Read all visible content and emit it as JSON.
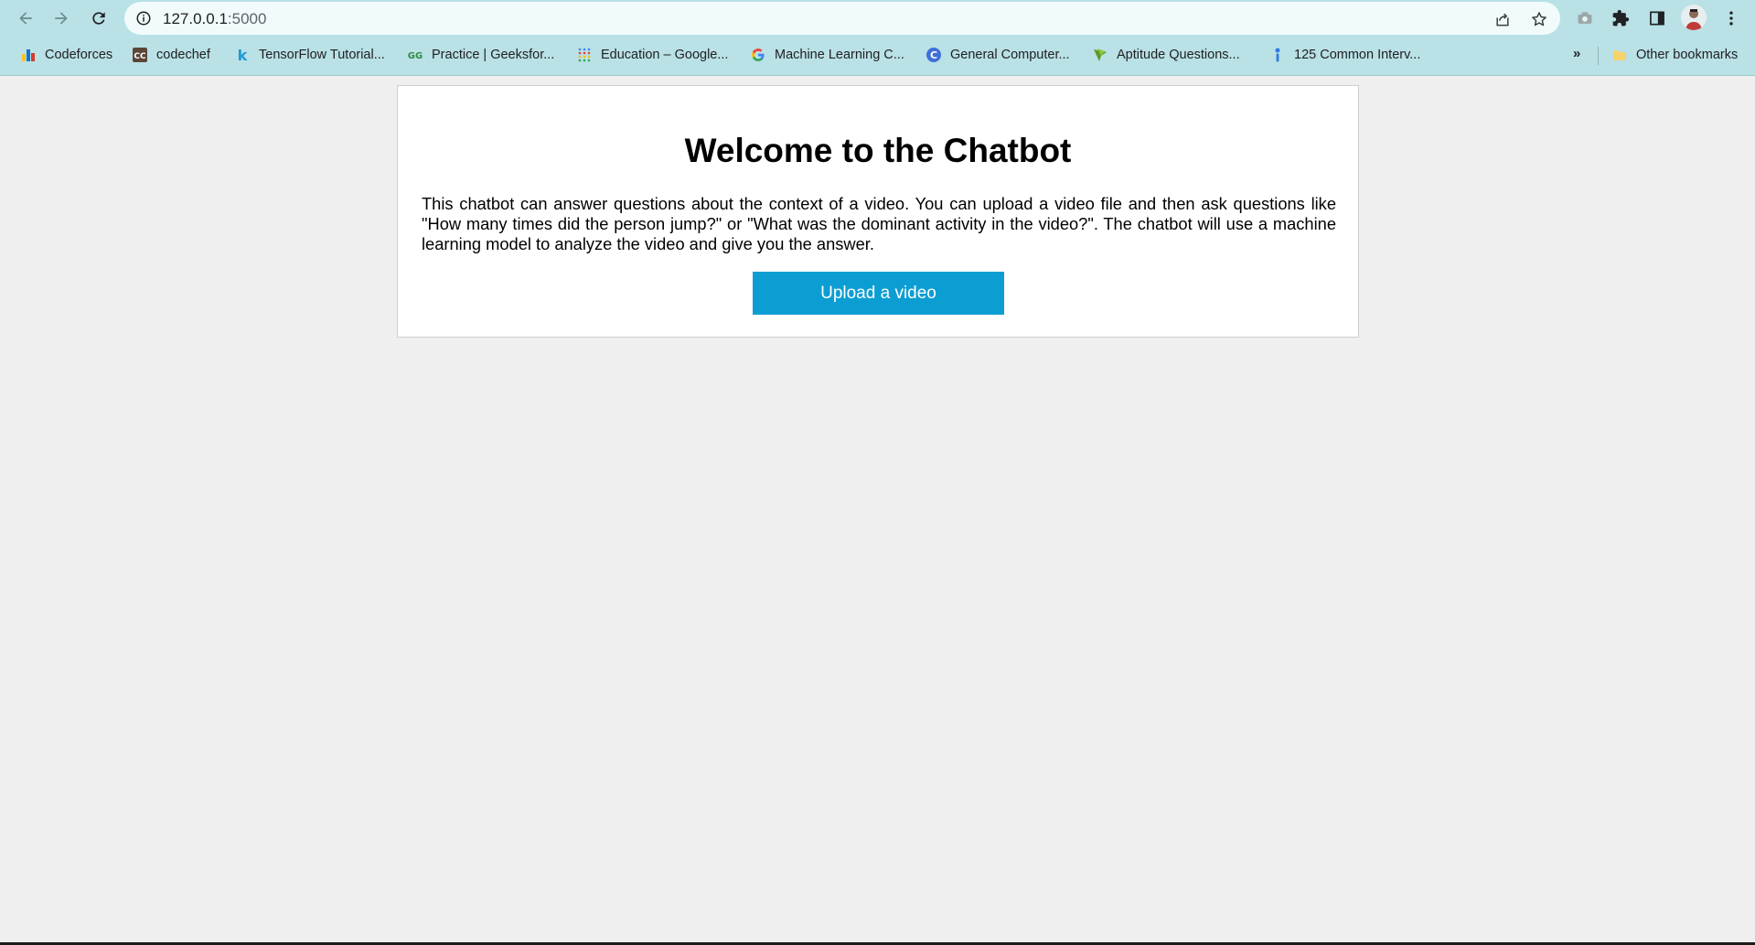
{
  "browser": {
    "url_host": "127.0.0.1",
    "url_port": ":5000",
    "bookmarks": [
      {
        "label": "Codeforces",
        "icon": "codeforces-icon"
      },
      {
        "label": "codechef",
        "icon": "codechef-icon"
      },
      {
        "label": "TensorFlow Tutorial...",
        "icon": "kaggle-icon"
      },
      {
        "label": "Practice | Geeksfor...",
        "icon": "geeksforgeeks-icon"
      },
      {
        "label": "Education – Google...",
        "icon": "google-education-icon"
      },
      {
        "label": "Machine Learning C...",
        "icon": "google-icon"
      },
      {
        "label": "General Computer...",
        "icon": "c-circle-icon"
      },
      {
        "label": "Aptitude Questions...",
        "icon": "indiabix-icon"
      },
      {
        "label": "125 Common Interv...",
        "icon": "info-pin-icon"
      }
    ],
    "more_bookmarks": "»",
    "other_bookmarks": "Other bookmarks"
  },
  "page": {
    "title": "Welcome to the Chatbot",
    "description": "This chatbot can answer questions about the context of a video. You can upload a video file and then ask questions like \"How many times did the person jump?\" or \"What was the dominant activity in the video?\". The chatbot will use a machine learning model to analyze the video and give you the answer.",
    "upload_button": "Upload a video"
  },
  "colors": {
    "chrome_bg": "#b9e1e6",
    "page_bg": "#efefef",
    "button_bg": "#0c9ed3"
  }
}
